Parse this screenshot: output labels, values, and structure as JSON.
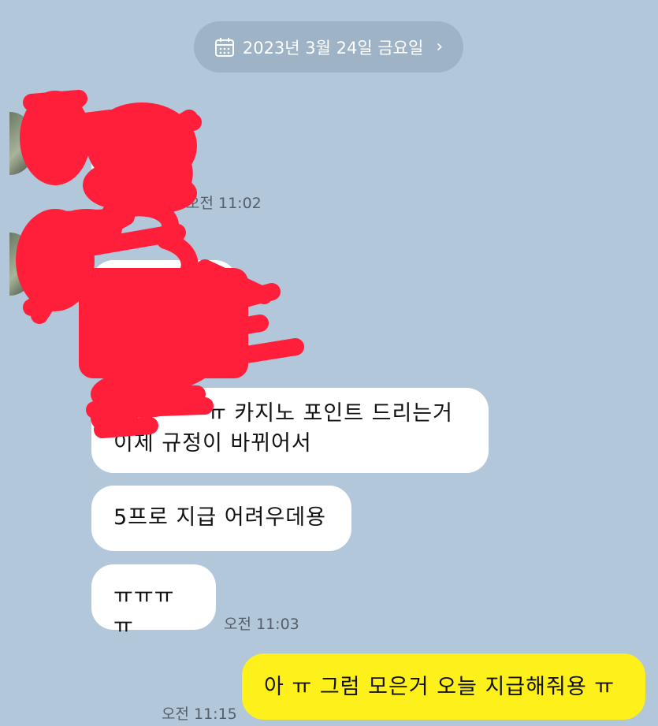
{
  "date_divider": {
    "label": "2023년 3월 24일 금요일",
    "chevron": "›",
    "icon": "calendar-icon"
  },
  "messages": {
    "m1": {
      "time": "오전 11:02"
    },
    "m3": {
      "line1": "ㅠ 카지노 포인트 드리는거",
      "line2": "이제 규정이 바뀌어서"
    },
    "m4": {
      "text": "5프로 지급 어려우데용"
    },
    "m5": {
      "text": "ㅠㅠㅠㅠ",
      "time": "오전 11:03"
    },
    "m6": {
      "text": "아 ㅠ 그럼 모은거 오늘 지급해줘용 ㅠ",
      "time": "오전 11:15"
    }
  },
  "colors": {
    "background": "#b2c7da",
    "my_bubble": "#fef01b",
    "their_bubble": "#ffffff",
    "redaction": "#ff1f3a"
  }
}
